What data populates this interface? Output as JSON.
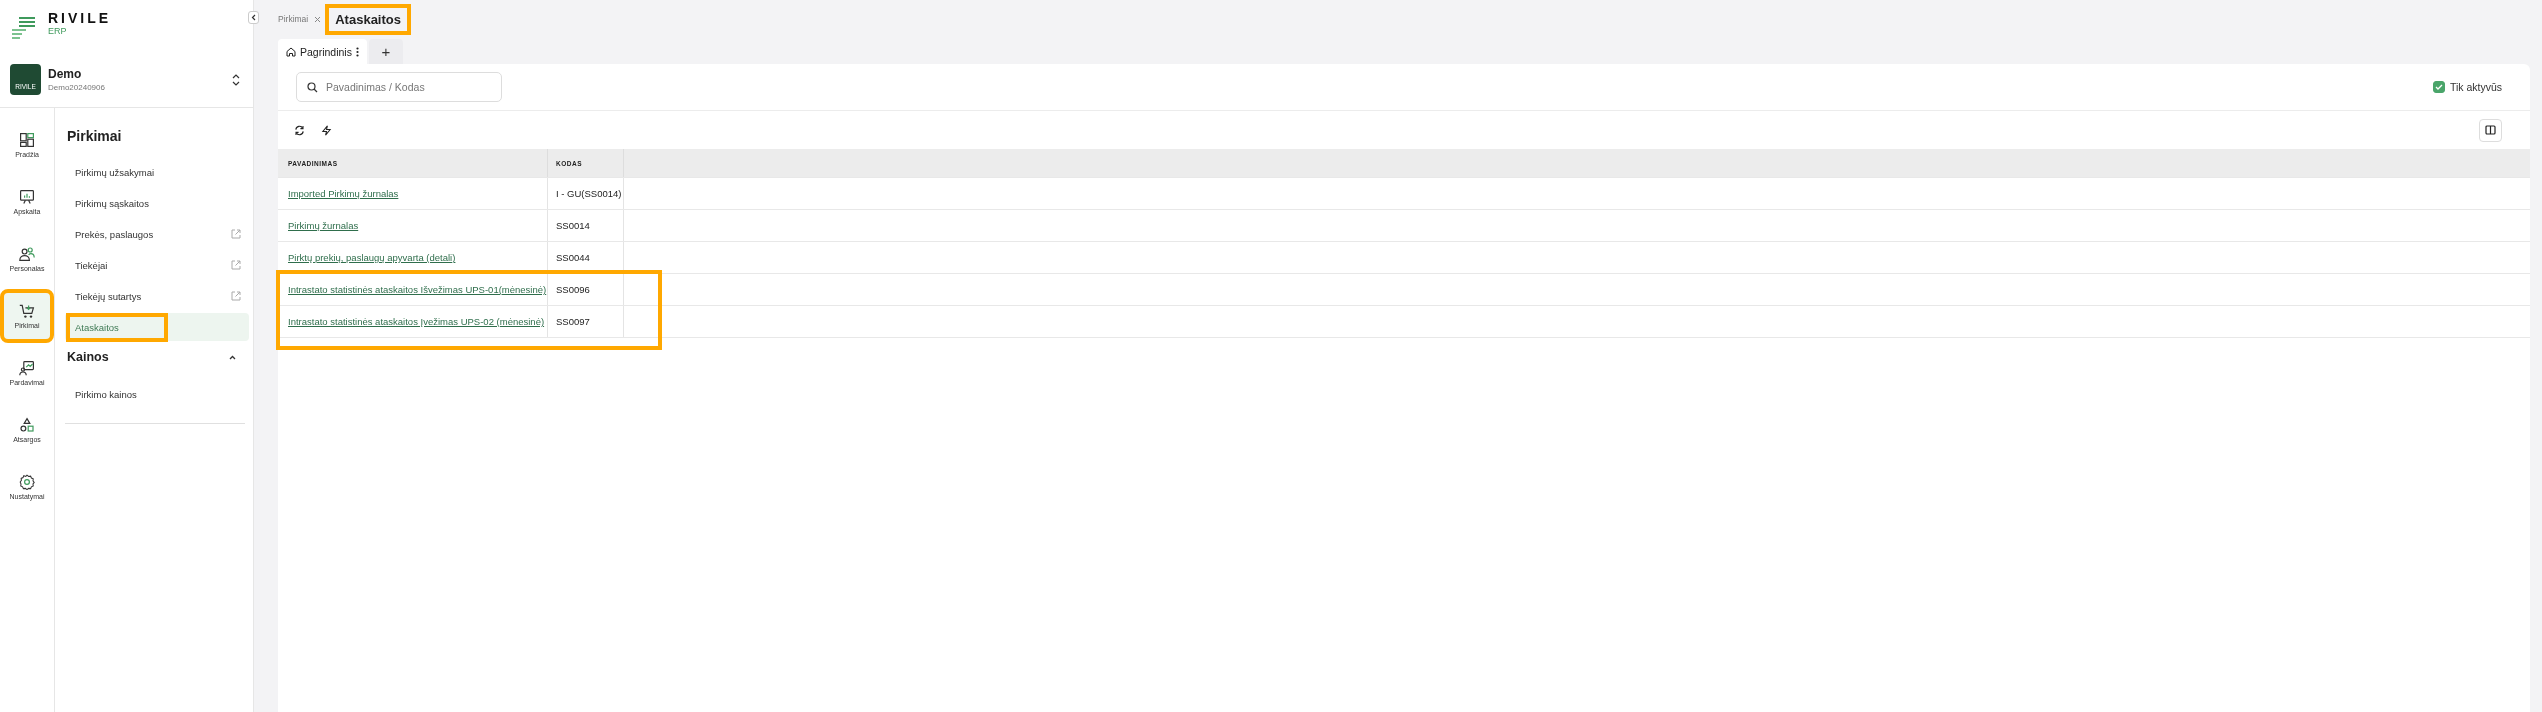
{
  "brand": {
    "name": "RIVILE",
    "sub": "ERP"
  },
  "company": {
    "badge": "RIVILE",
    "name": "Demo",
    "code": "Demo20240906"
  },
  "rail": [
    {
      "label": "Pradžia",
      "kind": "dashboard",
      "selected": false,
      "highlighted": false
    },
    {
      "label": "Apskaita",
      "kind": "chart",
      "selected": false,
      "highlighted": false
    },
    {
      "label": "Personalas",
      "kind": "people",
      "selected": false,
      "highlighted": false
    },
    {
      "label": "Pirkimai",
      "kind": "cart",
      "selected": true,
      "highlighted": true
    },
    {
      "label": "Pardavimai",
      "kind": "sales",
      "selected": false,
      "highlighted": false
    },
    {
      "label": "Atsargos",
      "kind": "shapes",
      "selected": false,
      "highlighted": false
    },
    {
      "label": "Nustatymai",
      "kind": "gear",
      "selected": false,
      "highlighted": false
    }
  ],
  "panel": {
    "sections": [
      {
        "title": "Pirkimai",
        "items": [
          {
            "label": "Pirkimų užsakymai",
            "external": false,
            "selected": false,
            "highlighted": false
          },
          {
            "label": "Pirkimų sąskaitos",
            "external": false,
            "selected": false,
            "highlighted": false
          },
          {
            "label": "Prekės, paslaugos",
            "external": true,
            "selected": false,
            "highlighted": false
          },
          {
            "label": "Tiekėjai",
            "external": true,
            "selected": false,
            "highlighted": false
          },
          {
            "label": "Tiekėjų sutartys",
            "external": true,
            "selected": false,
            "highlighted": false
          },
          {
            "label": "Ataskaitos",
            "external": false,
            "selected": true,
            "highlighted": true
          }
        ]
      },
      {
        "title": "Kainos",
        "expanded": true,
        "items": [
          {
            "label": "Pirkimo kainos",
            "external": false,
            "selected": false,
            "highlighted": false
          }
        ]
      }
    ]
  },
  "breadcrumb": {
    "parent": "Pirkimai",
    "current": "Ataskaitos",
    "highlighted": true
  },
  "tabs": [
    {
      "label": "Pagrindinis",
      "selected": true
    }
  ],
  "add_tab": "+",
  "search": {
    "placeholder": "Pavadinimas / Kodas"
  },
  "only_active": {
    "label": "Tik aktyvūs",
    "checked": true
  },
  "table": {
    "columns": [
      "PAVADINIMAS",
      "KODAS"
    ],
    "rows": [
      {
        "name": "Imported Pirkimų žurnalas",
        "code": "I - GU(SS0014)",
        "highlighted": false
      },
      {
        "name": "Pirkimų žurnalas",
        "code": "SS0014",
        "highlighted": false
      },
      {
        "name": "Pirktų prekių, paslaugų apyvarta (detali)",
        "code": "SS0044",
        "highlighted": false
      },
      {
        "name": "Intrastato statistinės ataskaitos Išvežimas UPS-01(mėnesinė)",
        "code": "SS0096",
        "highlighted": true
      },
      {
        "name": "Intrastato statistinės ataskaitos Įvežimas UPS-02 (mėnesinė)",
        "code": "SS0097",
        "highlighted": true
      }
    ]
  }
}
